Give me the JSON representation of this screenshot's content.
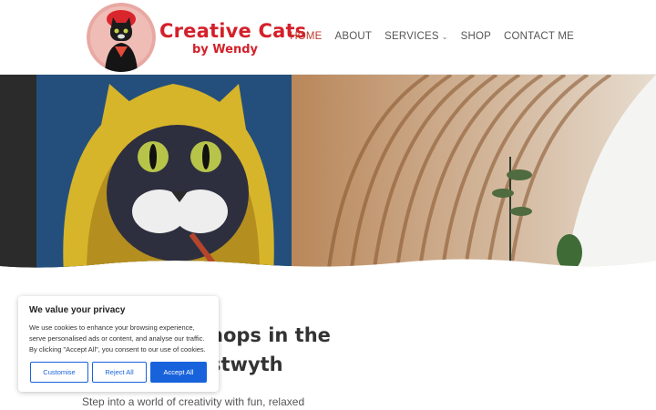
{
  "header": {
    "logo_title": "Creative Cats",
    "logo_sub": "by Wendy"
  },
  "nav": {
    "items": [
      {
        "label": "HOME",
        "active": true
      },
      {
        "label": "ABOUT",
        "active": false
      },
      {
        "label": "SERVICES",
        "active": false,
        "has_dropdown": true
      },
      {
        "label": "SHOP",
        "active": false
      },
      {
        "label": "CONTACT ME",
        "active": false
      }
    ],
    "active_color": "#c0392b"
  },
  "content": {
    "heading_line1": "hops in the",
    "heading_line2": "stwyth",
    "intro_text": "Step into a world of creativity with fun, relaxed"
  },
  "cookie_banner": {
    "title": "We value your privacy",
    "text_line1": "We use cookies to enhance your browsing experience,",
    "text_line2": "serve personalised ads or content, and analyse our traffic.",
    "text_line3": "By clicking \"Accept All\", you consent to our use of cookies.",
    "customise_label": "Customise",
    "reject_label": "Reject All",
    "accept_label": "Accept All",
    "accent_color": "#1863dc"
  },
  "colors": {
    "brand_red": "#d4202a"
  }
}
